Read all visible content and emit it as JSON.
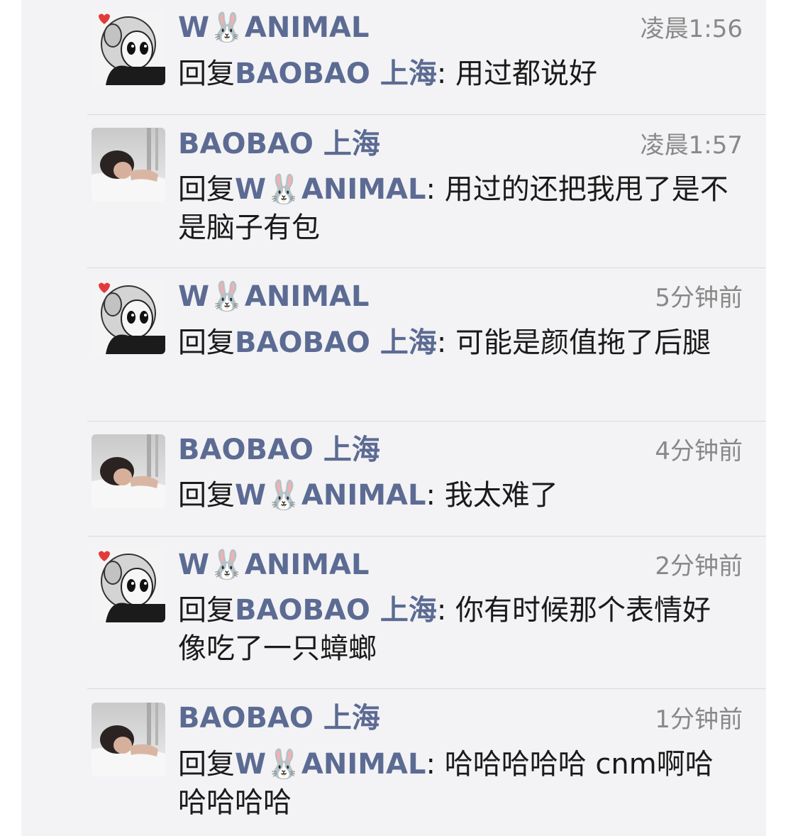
{
  "comments": [
    {
      "author": "W🐰ANIMAL",
      "avatar_icon": "cartoon-monkey-avatar",
      "time": "凌晨1:56",
      "reply_prefix": "回复",
      "reply_to": "BAOBAO 上海",
      "colon": ":",
      "text": " 用过都说好"
    },
    {
      "author": "BAOBAO 上海",
      "avatar_icon": "woman-photo-avatar",
      "time": "凌晨1:57",
      "reply_prefix": "回复",
      "reply_to": "W🐰ANIMAL",
      "colon": ":",
      "text": " 用过的还把我甩了是不是脑子有包"
    },
    {
      "author": "W🐰ANIMAL",
      "avatar_icon": "cartoon-monkey-avatar",
      "time": "5分钟前",
      "reply_prefix": "回复",
      "reply_to": "BAOBAO 上海",
      "colon": ":",
      "text": " 可能是颜值拖了后腿"
    },
    {
      "author": "BAOBAO 上海",
      "avatar_icon": "woman-photo-avatar",
      "time": "4分钟前",
      "reply_prefix": "回复",
      "reply_to": "W🐰ANIMAL",
      "colon": ":",
      "text": " 我太难了"
    },
    {
      "author": "W🐰ANIMAL",
      "avatar_icon": "cartoon-monkey-avatar",
      "time": "2分钟前",
      "reply_prefix": "回复",
      "reply_to": "BAOBAO 上海",
      "colon": ":",
      "text": " 你有时候那个表情好像吃了一只蟑螂"
    },
    {
      "author": "BAOBAO 上海",
      "avatar_icon": "woman-photo-avatar",
      "time": "1分钟前",
      "reply_prefix": "回复",
      "reply_to": "W🐰ANIMAL",
      "colon": ":",
      "text": " 哈哈哈哈哈 cnm啊哈哈哈哈哈"
    }
  ],
  "colors": {
    "name_link": "#5c6b93",
    "time_gray": "#888888",
    "panel_bg": "#f3f3f5",
    "divider": "#d9d9dc"
  }
}
